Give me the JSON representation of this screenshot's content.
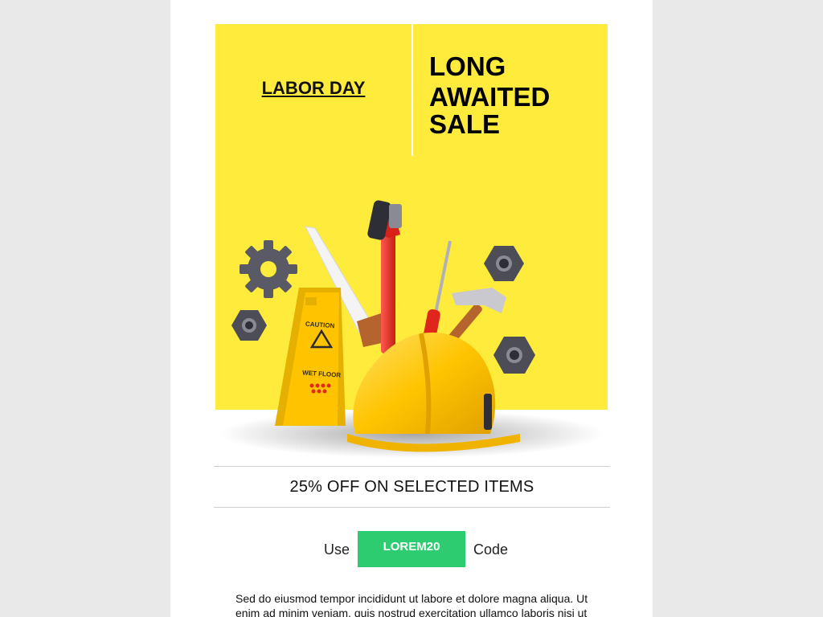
{
  "hero": {
    "left_title": "LABOR DAY",
    "right_line1": "LONG",
    "right_line2": "AWAITED SALE"
  },
  "illustration": {
    "caution_sign_text1": "CAUTION",
    "caution_sign_text2": "WET FLOOR"
  },
  "promo": {
    "text": "25% OFF ON SELECTED ITEMS"
  },
  "coupon": {
    "prefix": "Use",
    "code": "LOREM20",
    "suffix": "Code"
  },
  "body": {
    "paragraph": "Sed do eiusmod tempor incididunt ut labore et dolore magna aliqua. Ut enim ad minim veniam, quis nostrud exercitation ullamco laboris nisi ut"
  },
  "colors": {
    "hero_bg": "#ffeb3b",
    "code_button": "#2ecc71",
    "page_bg": "#e9e9e9"
  }
}
